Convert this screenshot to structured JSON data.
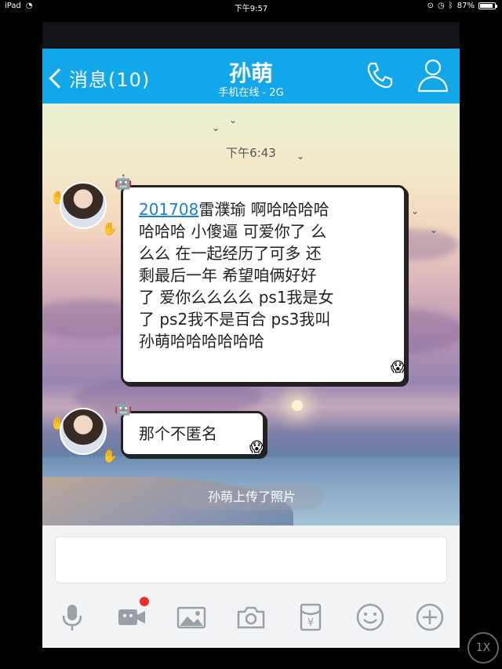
{
  "status_bar": {
    "device": "iPad",
    "time": "下午9:57",
    "battery_percent": "87%",
    "battery_level": 0.87
  },
  "navbar": {
    "back_label": "消息(10)",
    "title": "孙萌",
    "subtitle": "手机在线 - 2G",
    "phone_icon": "phone-icon",
    "profile_icon": "person-icon"
  },
  "chat": {
    "timestamp": "下午6:43",
    "messages": [
      {
        "link": "201708",
        "lines": [
          "雷濮瑜 啊哈哈哈哈",
          "哈哈哈 小傻逼 可爱你了 么",
          "么么 在一起经历了可多 还",
          "剩最后一年 希望咱俩好好",
          "了 爱你么么么么 ps1我是女",
          "了 ps2我不是百合 ps3我叫",
          "孙萌哈哈哈哈哈哈"
        ]
      },
      {
        "text": "那个不匿名"
      }
    ],
    "notice": "孙萌上传了照片"
  },
  "input": {
    "placeholder": ""
  },
  "toolbar": {
    "items": [
      "mic-icon",
      "video-icon",
      "image-icon",
      "camera-icon",
      "red-packet-icon",
      "emoji-icon",
      "plus-icon"
    ],
    "video_badge": true
  },
  "zoom_label": "1X",
  "colors": {
    "navbar": "#12a6ea",
    "link": "#1a7fd8",
    "badge": "#f02f2f"
  }
}
